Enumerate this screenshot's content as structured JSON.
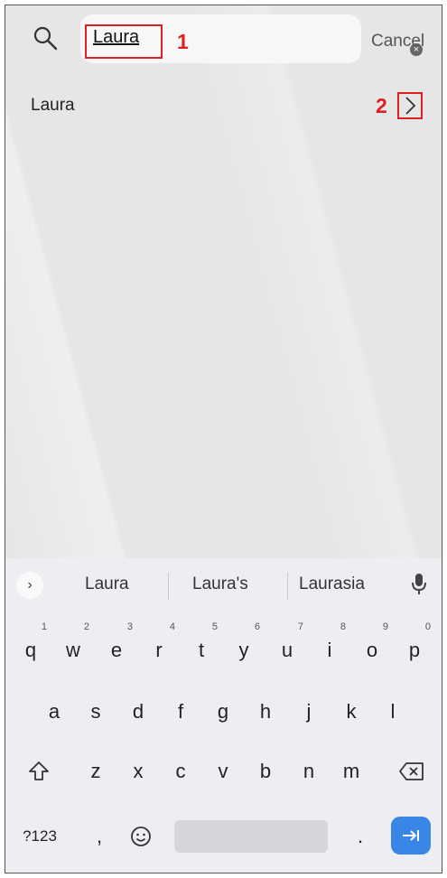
{
  "search": {
    "value": "Laura",
    "clear_icon": "close-circle-icon",
    "cancel_label": "Cancel"
  },
  "markers": {
    "one": "1",
    "two": "2"
  },
  "results": [
    {
      "label": "Laura"
    }
  ],
  "keyboard": {
    "suggestions": [
      "Laura",
      "Laura's",
      "Laurasia"
    ],
    "row1": [
      {
        "key": "q",
        "hint": "1"
      },
      {
        "key": "w",
        "hint": "2"
      },
      {
        "key": "e",
        "hint": "3"
      },
      {
        "key": "r",
        "hint": "4"
      },
      {
        "key": "t",
        "hint": "5"
      },
      {
        "key": "y",
        "hint": "6"
      },
      {
        "key": "u",
        "hint": "7"
      },
      {
        "key": "i",
        "hint": "8"
      },
      {
        "key": "o",
        "hint": "9"
      },
      {
        "key": "p",
        "hint": "0"
      }
    ],
    "row2": [
      "a",
      "s",
      "d",
      "f",
      "g",
      "h",
      "j",
      "k",
      "l"
    ],
    "row3": [
      "z",
      "x",
      "c",
      "v",
      "b",
      "n",
      "m"
    ],
    "symbols_label": "?123",
    "comma": ",",
    "period": "."
  },
  "colors": {
    "highlight": "#e02020",
    "accent": "#3a86e6"
  }
}
